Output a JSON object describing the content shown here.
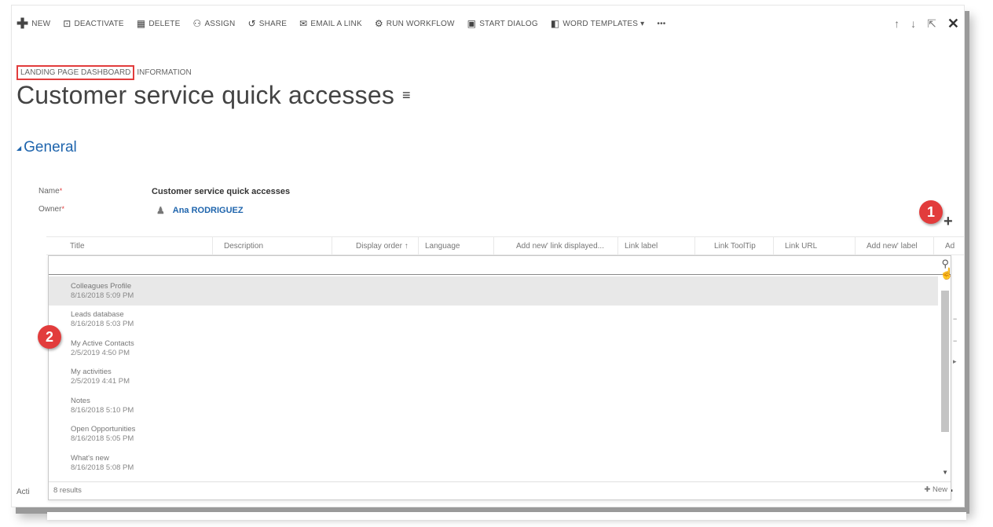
{
  "toolbar": {
    "items": [
      {
        "icon": "✚",
        "label": "NEW"
      },
      {
        "icon": "⊡",
        "label": "DEACTIVATE"
      },
      {
        "icon": "▦",
        "label": "DELETE"
      },
      {
        "icon": "⚇",
        "label": "ASSIGN"
      },
      {
        "icon": "↺",
        "label": "SHARE"
      },
      {
        "icon": "✉",
        "label": "EMAIL A LINK"
      },
      {
        "icon": "⚙",
        "label": "RUN WORKFLOW"
      },
      {
        "icon": "▣",
        "label": "START DIALOG"
      },
      {
        "icon": "◧",
        "label": "WORD TEMPLATES ▾"
      },
      {
        "icon": "",
        "label": "•••"
      }
    ]
  },
  "breadcrumb": {
    "entity": "LANDING PAGE DASHBOARD",
    "form": "INFORMATION"
  },
  "record": {
    "title": "Customer service quick accesses"
  },
  "section": {
    "name": "General"
  },
  "fields": {
    "name_label": "Name",
    "name_value": "Customer service quick accesses",
    "owner_label": "Owner",
    "owner_value": "Ana RODRIGUEZ",
    "required_mark": "*"
  },
  "badges": {
    "one": "1",
    "two": "2"
  },
  "grid": {
    "columns": [
      "Title",
      "Description",
      "Display order ↑",
      "Language",
      "Add new' link displayed...",
      "Link label",
      "Link ToolTip",
      "Link URL",
      "Add new' label",
      "Ad"
    ]
  },
  "lookup": {
    "results": [
      {
        "name": "Colleagues Profile",
        "date": "8/16/2018 5:09 PM"
      },
      {
        "name": "Leads database",
        "date": "8/16/2018 5:03 PM"
      },
      {
        "name": "My Active Contacts",
        "date": "2/5/2019 4:50 PM"
      },
      {
        "name": "My activities",
        "date": "2/5/2019 4:41 PM"
      },
      {
        "name": "Notes",
        "date": "8/16/2018 5:10 PM"
      },
      {
        "name": "Open Opportunities",
        "date": "8/16/2018 5:05 PM"
      },
      {
        "name": "What's new",
        "date": "8/16/2018 5:08 PM"
      }
    ],
    "count": "8 results",
    "new_label": "✚ New"
  },
  "background": {
    "acti": "Acti"
  },
  "colors": {
    "accent": "#1f65ad",
    "badge": "#e23c3c"
  }
}
